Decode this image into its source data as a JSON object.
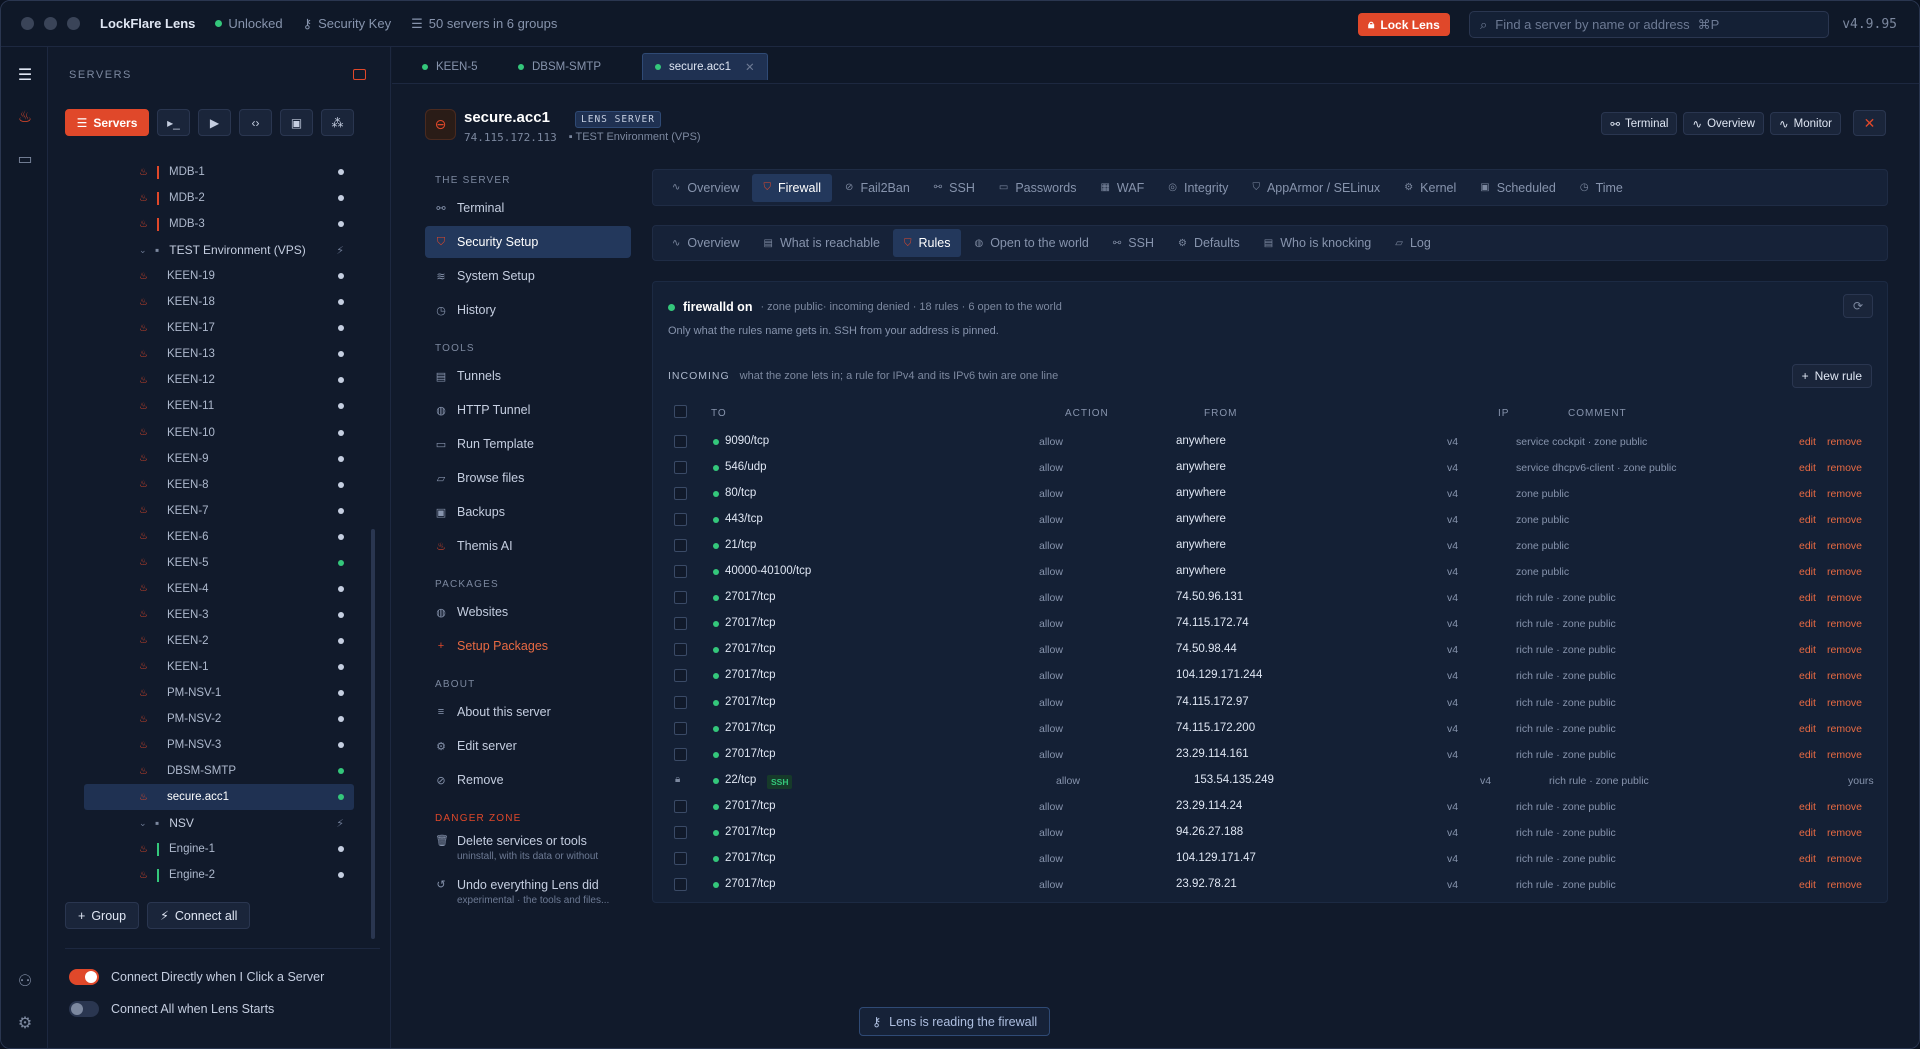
{
  "titlebar": {
    "app_name": "LockFlare Lens",
    "status": "Unlocked",
    "key_label": "Security Key",
    "servers_summary": "50 servers in 6 groups",
    "lock_button": "Lock Lens",
    "search_placeholder": "Find a server by name or address",
    "search_shortcut": "⌘P",
    "version": "v4.9.95"
  },
  "sidebar": {
    "header": "SERVERS",
    "active_tool": "Servers",
    "tree": [
      {
        "type": "server",
        "name": "MDB-1",
        "bar": "red",
        "status": "white"
      },
      {
        "type": "server",
        "name": "MDB-2",
        "bar": "red",
        "status": "white"
      },
      {
        "type": "server",
        "name": "MDB-3",
        "bar": "red",
        "status": "white"
      },
      {
        "type": "group",
        "name": "TEST Environment (VPS)"
      },
      {
        "type": "server",
        "name": "KEEN-19",
        "status": "white"
      },
      {
        "type": "server",
        "name": "KEEN-18",
        "status": "white"
      },
      {
        "type": "server",
        "name": "KEEN-17",
        "status": "white"
      },
      {
        "type": "server",
        "name": "KEEN-13",
        "status": "white"
      },
      {
        "type": "server",
        "name": "KEEN-12",
        "status": "white"
      },
      {
        "type": "server",
        "name": "KEEN-11",
        "status": "white"
      },
      {
        "type": "server",
        "name": "KEEN-10",
        "status": "white"
      },
      {
        "type": "server",
        "name": "KEEN-9",
        "status": "white"
      },
      {
        "type": "server",
        "name": "KEEN-8",
        "status": "white"
      },
      {
        "type": "server",
        "name": "KEEN-7",
        "status": "white"
      },
      {
        "type": "server",
        "name": "KEEN-6",
        "status": "white"
      },
      {
        "type": "server",
        "name": "KEEN-5",
        "status": "green"
      },
      {
        "type": "server",
        "name": "KEEN-4",
        "status": "white"
      },
      {
        "type": "server",
        "name": "KEEN-3",
        "status": "white"
      },
      {
        "type": "server",
        "name": "KEEN-2",
        "status": "white"
      },
      {
        "type": "server",
        "name": "KEEN-1",
        "status": "white"
      },
      {
        "type": "server",
        "name": "PM-NSV-1",
        "status": "white"
      },
      {
        "type": "server",
        "name": "PM-NSV-2",
        "status": "white"
      },
      {
        "type": "server",
        "name": "PM-NSV-3",
        "status": "white"
      },
      {
        "type": "server",
        "name": "DBSM-SMTP",
        "status": "green"
      },
      {
        "type": "server",
        "name": "secure.acc1",
        "status": "green",
        "selected": true
      },
      {
        "type": "group",
        "name": "NSV"
      },
      {
        "type": "server",
        "name": "Engine-1",
        "bar": "green",
        "status": "white"
      },
      {
        "type": "server",
        "name": "Engine-2",
        "bar": "green",
        "status": "white"
      }
    ],
    "group_button": "Group",
    "connect_all_button": "Connect all",
    "toggle_direct": "Connect Directly when I Click a Server",
    "toggle_direct_on": true,
    "toggle_startup": "Connect All when Lens Starts",
    "toggle_startup_on": false
  },
  "tabs": [
    "KEEN-5",
    "DBSM-SMTP",
    "secure.acc1"
  ],
  "server": {
    "name": "secure.acc1",
    "badge": "LENS SERVER",
    "address": "74.115.172.113",
    "group": "TEST Environment (VPS)",
    "actions": [
      "Terminal",
      "Overview",
      "Monitor"
    ]
  },
  "inner_nav": {
    "the_server": "THE SERVER",
    "terminal": "Terminal",
    "security_setup": "Security Setup",
    "system_setup": "System Setup",
    "history": "History",
    "tools": "TOOLS",
    "tunnels": "Tunnels",
    "http_tunnel": "HTTP Tunnel",
    "run_template": "Run Template",
    "browse_files": "Browse files",
    "backups": "Backups",
    "themis_ai": "Themis AI",
    "packages": "PACKAGES",
    "websites": "Websites",
    "setup_packages": "Setup Packages",
    "about": "ABOUT",
    "about_server": "About this server",
    "edit_server": "Edit server",
    "remove": "Remove",
    "danger_zone": "DANGER ZONE",
    "delete_services": "Delete services or tools",
    "delete_services_sub": "uninstall, with its data or without",
    "undo_everything": "Undo everything Lens did",
    "undo_everything_sub": "experimental · the tools and files..."
  },
  "security_tabs": [
    "Overview",
    "Firewall",
    "Fail2Ban",
    "SSH",
    "Passwords",
    "WAF",
    "Integrity",
    "AppArmor / SELinux",
    "Kernel",
    "Scheduled",
    "Time"
  ],
  "firewall_tabs": [
    "Overview",
    "What is reachable",
    "Rules",
    "Open to the world",
    "SSH",
    "Defaults",
    "Who is knocking",
    "Log"
  ],
  "firewall": {
    "status": "firewalld on",
    "meta": "· zone public· incoming denied · 18 rules · 6 open to the world",
    "note": "Only what the rules name gets in. SSH from your address is pinned.",
    "incoming_label": "INCOMING",
    "incoming_desc": "what the zone lets in; a rule for IPv4 and its IPv6 twin are one line",
    "new_rule": "New rule",
    "columns": [
      "TO",
      "ACTION",
      "FROM",
      "IP",
      "COMMENT"
    ],
    "rules": [
      {
        "to": "9090/tcp",
        "action": "allow",
        "from": "anywhere",
        "ip": "v4",
        "comment": "service cockpit · zone public"
      },
      {
        "to": "546/udp",
        "action": "allow",
        "from": "anywhere",
        "ip": "v4",
        "comment": "service dhcpv6-client · zone public"
      },
      {
        "to": "80/tcp",
        "action": "allow",
        "from": "anywhere",
        "ip": "v4",
        "comment": "zone public"
      },
      {
        "to": "443/tcp",
        "action": "allow",
        "from": "anywhere",
        "ip": "v4",
        "comment": "zone public"
      },
      {
        "to": "21/tcp",
        "action": "allow",
        "from": "anywhere",
        "ip": "v4",
        "comment": "zone public"
      },
      {
        "to": "40000-40100/tcp",
        "action": "allow",
        "from": "anywhere",
        "ip": "v4",
        "comment": "zone public"
      },
      {
        "to": "27017/tcp",
        "action": "allow",
        "from": "74.50.96.131",
        "ip": "v4",
        "comment": "rich rule · zone public"
      },
      {
        "to": "27017/tcp",
        "action": "allow",
        "from": "74.115.172.74",
        "ip": "v4",
        "comment": "rich rule · zone public"
      },
      {
        "to": "27017/tcp",
        "action": "allow",
        "from": "74.50.98.44",
        "ip": "v4",
        "comment": "rich rule · zone public"
      },
      {
        "to": "27017/tcp",
        "action": "allow",
        "from": "104.129.171.244",
        "ip": "v4",
        "comment": "rich rule · zone public"
      },
      {
        "to": "27017/tcp",
        "action": "allow",
        "from": "74.115.172.97",
        "ip": "v4",
        "comment": "rich rule · zone public"
      },
      {
        "to": "27017/tcp",
        "action": "allow",
        "from": "74.115.172.200",
        "ip": "v4",
        "comment": "rich rule · zone public"
      },
      {
        "to": "27017/tcp",
        "action": "allow",
        "from": "23.29.114.161",
        "ip": "v4",
        "comment": "rich rule · zone public"
      },
      {
        "to": "22/tcp",
        "badge": "SSH",
        "pinned": true,
        "action": "allow",
        "from": "153.54.135.249",
        "ip": "v4",
        "comment": "rich rule · zone public",
        "owner": "yours"
      },
      {
        "to": "27017/tcp",
        "action": "allow",
        "from": "23.29.114.24",
        "ip": "v4",
        "comment": "rich rule · zone public"
      },
      {
        "to": "27017/tcp",
        "action": "allow",
        "from": "94.26.27.188",
        "ip": "v4",
        "comment": "rich rule · zone public"
      },
      {
        "to": "27017/tcp",
        "action": "allow",
        "from": "104.129.171.47",
        "ip": "v4",
        "comment": "rich rule · zone public"
      },
      {
        "to": "27017/tcp",
        "action": "allow",
        "from": "23.92.78.21",
        "ip": "v4",
        "comment": "rich rule · zone public"
      }
    ],
    "edit_label": "edit",
    "remove_label": "remove"
  },
  "toast": "Lens is reading the firewall",
  "colors": {
    "accent": "#e0482a",
    "online": "#34c77b",
    "background": "#111a2b"
  }
}
